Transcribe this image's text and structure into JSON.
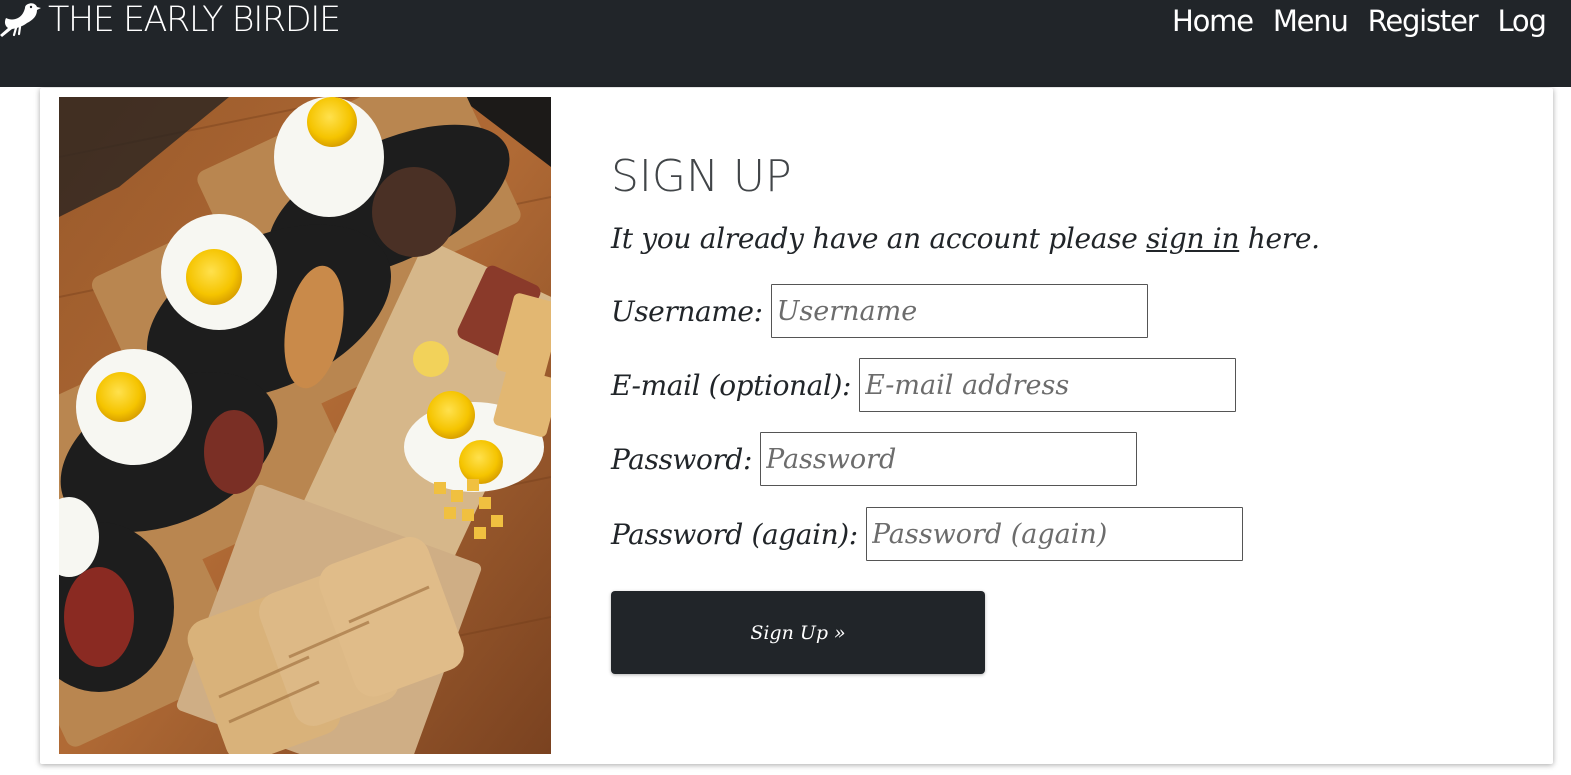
{
  "navbar": {
    "logo_icon": "bird-icon",
    "brand": "THE EARLY BIRDIE",
    "links": [
      "Home",
      "Menu",
      "Register",
      "Log"
    ]
  },
  "image": {
    "subject": "food-photo-icon"
  },
  "signup": {
    "title": "SIGN UP",
    "intro_before": "It you already have an account please ",
    "intro_link": "sign in",
    "intro_after": " here.",
    "fields": [
      {
        "label": "Username:",
        "placeholder": "Username"
      },
      {
        "label": "E-mail (optional):",
        "placeholder": "E-mail address"
      },
      {
        "label": "Password:",
        "placeholder": "Password"
      },
      {
        "label": "Password (again):",
        "placeholder": "Password (again)"
      }
    ],
    "submit_label": "Sign Up »"
  },
  "colors": {
    "navbar_bg": "#212529",
    "button_bg": "#212529",
    "text": "#212529"
  }
}
